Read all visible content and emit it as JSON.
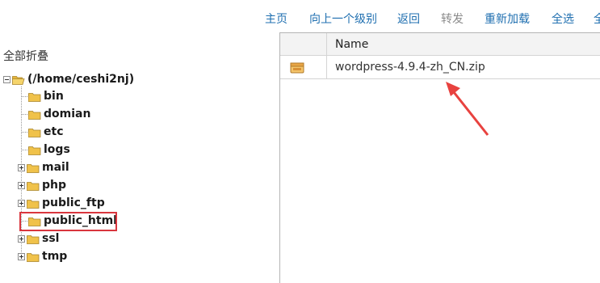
{
  "toolbar": {
    "items": [
      {
        "label": "主页",
        "enabled": true
      },
      {
        "label": "向上一个级别",
        "enabled": true
      },
      {
        "label": "返回",
        "enabled": true
      },
      {
        "label": "转发",
        "enabled": false
      },
      {
        "label": "重新加载",
        "enabled": true
      },
      {
        "label": "全选",
        "enabled": true
      },
      {
        "label": "全",
        "enabled": true
      }
    ]
  },
  "tree": {
    "collapse_all_label": "全部折叠",
    "root": {
      "label": "(/home/ceshi2nj)",
      "expanded": true,
      "icon": "open-folder-icon"
    },
    "children": [
      {
        "label": "bin",
        "expandable": false
      },
      {
        "label": "domian",
        "expandable": false
      },
      {
        "label": "etc",
        "expandable": false
      },
      {
        "label": "logs",
        "expandable": false
      },
      {
        "label": "mail",
        "expandable": true
      },
      {
        "label": "php",
        "expandable": true
      },
      {
        "label": "public_ftp",
        "expandable": true
      },
      {
        "label": "public_html",
        "expandable": false,
        "highlighted": true
      },
      {
        "label": "ssl",
        "expandable": true
      },
      {
        "label": "tmp",
        "expandable": true
      }
    ]
  },
  "file_list": {
    "columns": {
      "name": "Name"
    },
    "rows": [
      {
        "name": "wordpress-4.9.4-zh_CN.zip",
        "icon": "zip-archive-icon"
      }
    ]
  },
  "colors": {
    "link": "#1f6fb0",
    "disabled": "#8a8a8a",
    "highlight_border": "#d9363e",
    "folder": "#f0c24a",
    "annotation_arrow": "#e8423f"
  }
}
